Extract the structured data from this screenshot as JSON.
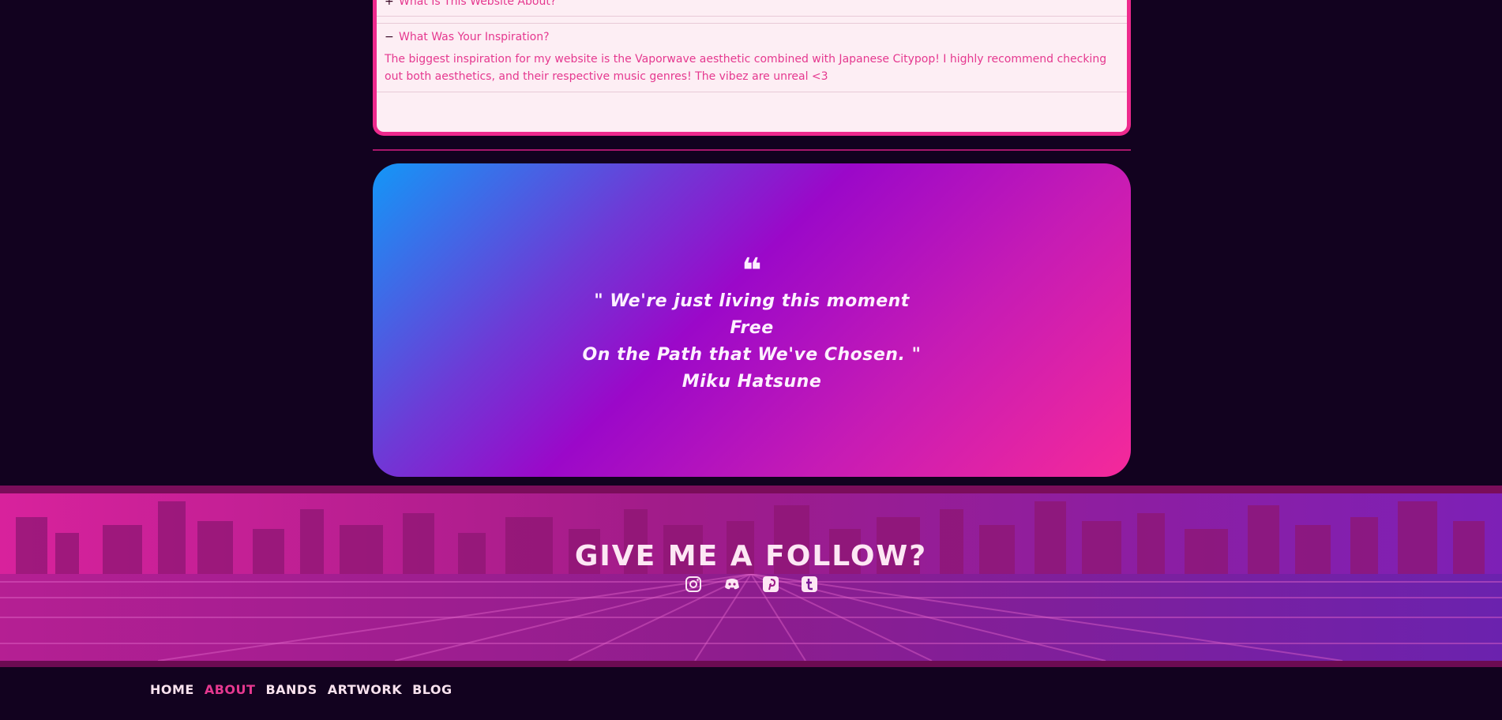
{
  "faq": {
    "items": [
      {
        "sign": "+",
        "question": "What Is This Website About?"
      },
      {
        "sign": "−",
        "question": "What Was Your Inspiration?",
        "answer": "The biggest inspiration for my website is the Vaporwave aesthetic combined with Japanese Citypop! I highly recommend checking out both aesthetics, and their respective music genres! The vibez are unreal <3"
      }
    ]
  },
  "quote": {
    "mark": "❝",
    "lines": [
      "\" We're just living this moment",
      "Free",
      "On the Path that We've Chosen. \"",
      "Miku Hatsune"
    ]
  },
  "follow": {
    "title": "GIVE ME A FOLLOW?",
    "socials": [
      {
        "icon": "instagram-icon"
      },
      {
        "icon": "discord-icon"
      },
      {
        "icon": "pinterest-icon"
      },
      {
        "icon": "tumblr-icon"
      }
    ]
  },
  "nav": {
    "items": [
      {
        "label": "HOME",
        "active": false
      },
      {
        "label": "ABOUT",
        "active": true
      },
      {
        "label": "BANDS",
        "active": false
      },
      {
        "label": "ARTWORK",
        "active": false
      },
      {
        "label": "BLOG",
        "active": false
      }
    ]
  },
  "colors": {
    "background": "#12021f",
    "accent": "#e5388f",
    "faq_bg": "#fdeef4",
    "faq_border": "#ee2a8d"
  }
}
